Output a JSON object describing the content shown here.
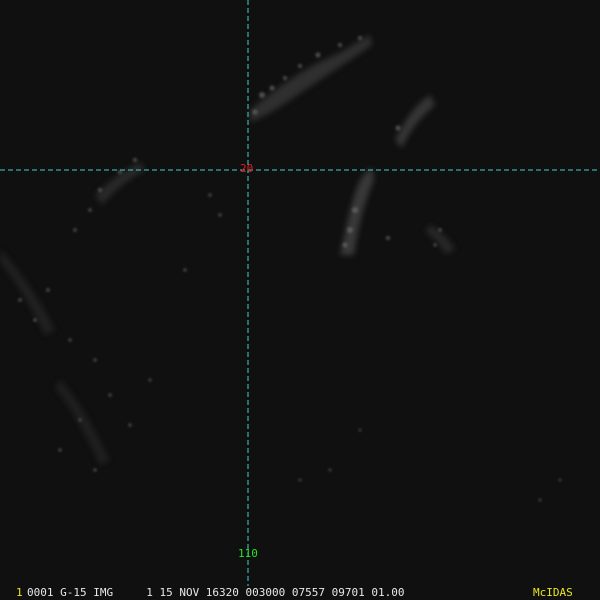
{
  "colors": {
    "background": "#101010",
    "grid_lines": "#3fd0d0",
    "latitude_label": "#e01818",
    "longitude_label": "#28e028",
    "status_text": "#e8e8e8",
    "frame_number": "#e8e820",
    "brand": "#e8e820"
  },
  "grid": {
    "latitude_label": "20",
    "longitude_label": "110"
  },
  "status_bar": {
    "frame_number": "1",
    "text": "0001 G-15 IMG     1 15 NOV 16320 003000 07557 09701 01.00",
    "brand": "McIDAS"
  }
}
